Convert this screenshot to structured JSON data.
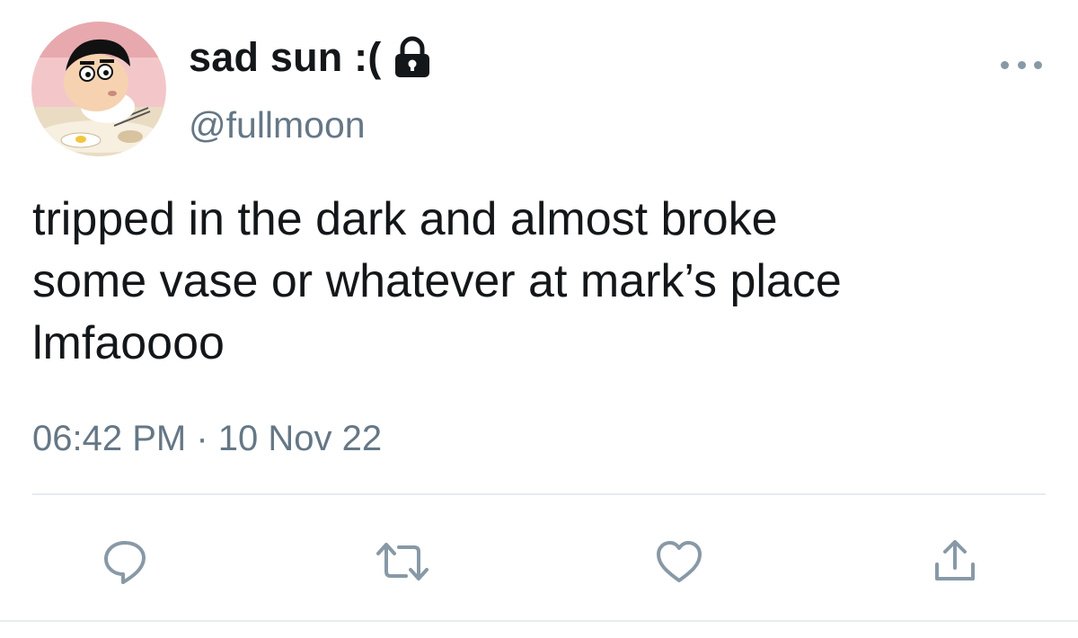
{
  "user": {
    "display_name": "sad sun :(",
    "handle": "@fullmoon",
    "protected": true,
    "lock_icon": "lock-icon",
    "avatar_icon": "avatar"
  },
  "tweet": {
    "text": "tripped in the dark and almost broke\nsome vase or whatever at mark’s place\nlmfaoooo",
    "timestamp": "06:42 PM · 10 Nov 22"
  },
  "actions": [
    {
      "name": "reply",
      "icon": "reply-icon"
    },
    {
      "name": "retweet",
      "icon": "retweet-icon"
    },
    {
      "name": "like",
      "icon": "heart-icon"
    },
    {
      "name": "share",
      "icon": "share-icon"
    }
  ],
  "colors": {
    "text_primary": "#14171a",
    "text_secondary": "#657786",
    "icon_gray": "#8899a6",
    "divider": "#e6ecf0"
  }
}
